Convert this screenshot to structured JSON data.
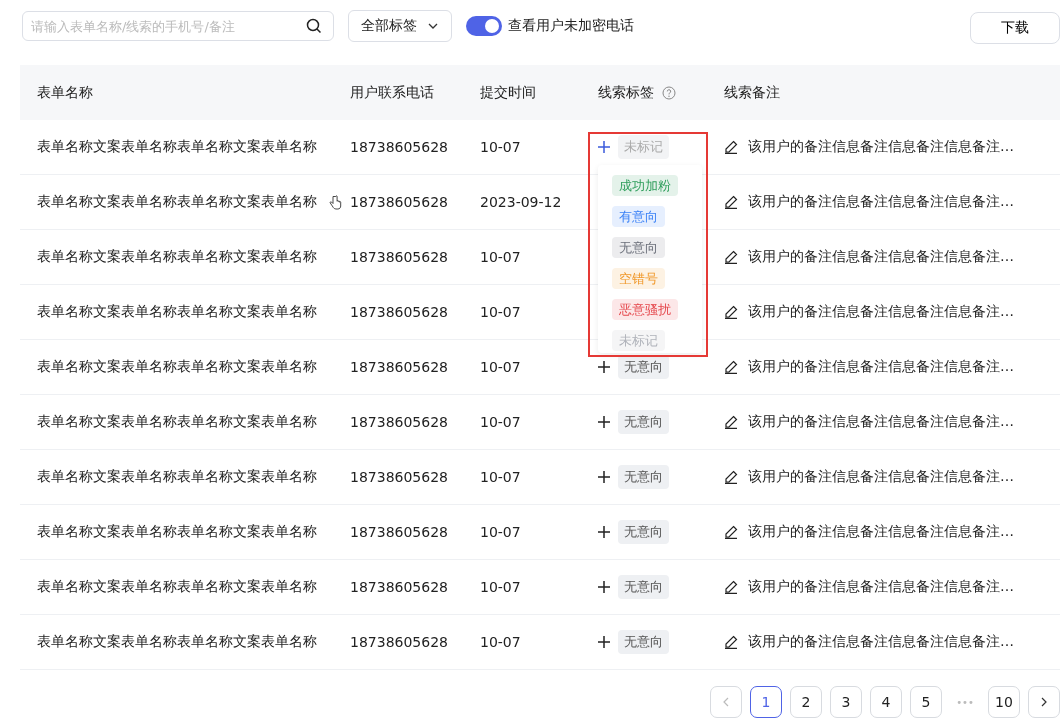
{
  "toolbar": {
    "search": {
      "placeholder": "请输入表单名称/线索的手机号/备注"
    },
    "tag_filter": {
      "value": "全部标签"
    },
    "toggle": {
      "label": "查看用户未加密电话",
      "on": true
    },
    "download_button": "下载"
  },
  "table": {
    "columns": [
      "表单名称",
      "用户联系电话",
      "提交时间",
      "线索标签",
      "线索备注"
    ],
    "rows": [
      {
        "name": "表单名称文案表单名称表单名称文案表单名称",
        "phone": "18738605628",
        "time": "10-07",
        "tag": "未标记",
        "note": "该用户的备注信息备注信息备注信息备注…"
      },
      {
        "name": "表单名称文案表单名称表单名称文案表单名称",
        "phone": "18738605628",
        "time": "2023-09-12",
        "note": "该用户的备注信息备注信息备注信息备注…"
      },
      {
        "name": "表单名称文案表单名称表单名称文案表单名称",
        "phone": "18738605628",
        "time": "10-07",
        "note": "该用户的备注信息备注信息备注信息备注…"
      },
      {
        "name": "表单名称文案表单名称表单名称文案表单名称",
        "phone": "18738605628",
        "time": "10-07",
        "note": "该用户的备注信息备注信息备注信息备注…"
      },
      {
        "name": "表单名称文案表单名称表单名称文案表单名称",
        "phone": "18738605628",
        "time": "10-07",
        "tag": "无意向",
        "note": "该用户的备注信息备注信息备注信息备注…"
      },
      {
        "name": "表单名称文案表单名称表单名称文案表单名称",
        "phone": "18738605628",
        "time": "10-07",
        "tag": "无意向",
        "note": "该用户的备注信息备注信息备注信息备注…"
      },
      {
        "name": "表单名称文案表单名称表单名称文案表单名称",
        "phone": "18738605628",
        "time": "10-07",
        "tag": "无意向",
        "note": "该用户的备注信息备注信息备注信息备注…"
      },
      {
        "name": "表单名称文案表单名称表单名称文案表单名称",
        "phone": "18738605628",
        "time": "10-07",
        "tag": "无意向",
        "note": "该用户的备注信息备注信息备注信息备注…"
      },
      {
        "name": "表单名称文案表单名称表单名称文案表单名称",
        "phone": "18738605628",
        "time": "10-07",
        "tag": "无意向",
        "note": "该用户的备注信息备注信息备注信息备注…"
      },
      {
        "name": "表单名称文案表单名称表单名称文案表单名称",
        "phone": "18738605628",
        "time": "10-07",
        "tag": "无意向",
        "note": "该用户的备注信息备注信息备注信息备注…"
      }
    ]
  },
  "tag_menu": {
    "options": [
      {
        "label": "成功加粉",
        "color": "#2e9e5b"
      },
      {
        "label": "有意向",
        "color": "#3b82f6"
      },
      {
        "label": "无意向",
        "color": "#6b6f7a"
      },
      {
        "label": "空错号",
        "color": "#f0982a"
      },
      {
        "label": "恶意骚扰",
        "color": "#e5484d"
      },
      {
        "label": "未标记",
        "color": "#b0b3ba"
      }
    ]
  },
  "pagination": {
    "pages": [
      {
        "label": "1",
        "selected": true
      },
      {
        "label": "2",
        "selected": false
      },
      {
        "label": "3",
        "selected": false
      },
      {
        "label": "4",
        "selected": false
      },
      {
        "label": "5",
        "selected": false
      },
      {
        "label": "10",
        "selected": false,
        "kind": "last"
      }
    ],
    "ellipsis": "•••"
  }
}
